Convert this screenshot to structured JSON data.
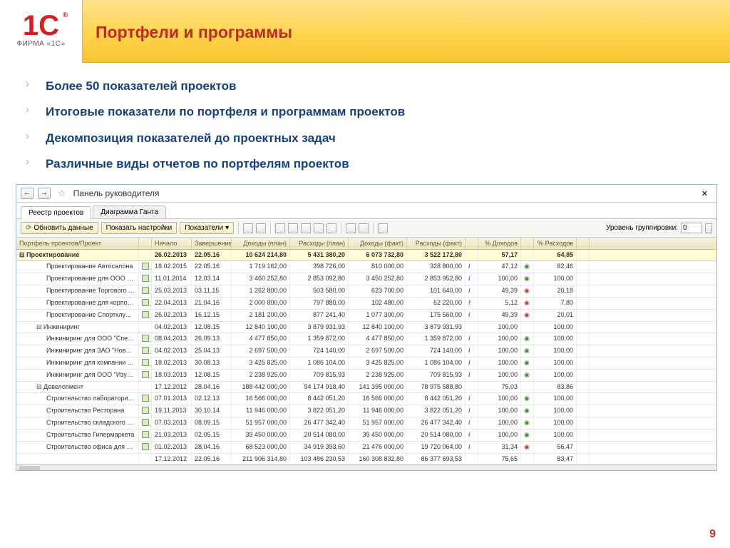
{
  "logo": {
    "text": "1C",
    "sub": "ФИРМА «1С»"
  },
  "title": "Портфели и программы",
  "bullets": [
    "Более 50 показателей проектов",
    "Итоговые показатели по портфеля и программам проектов",
    "Декомпозиция показателей до проектных задач",
    "Различные виды отчетов по портфелям проектов"
  ],
  "window": {
    "title": "Панель руководителя",
    "tabs": [
      "Реестр проектов",
      "Диаграмма Ганта"
    ],
    "refresh": "Обновить данные",
    "show_settings": "Показать настройки",
    "indicators": "Показатели",
    "group_label": "Уровень группировки:",
    "group_value": "0"
  },
  "columns": [
    "Портфель проектов/Проект",
    "",
    "Начало",
    "Завершение",
    "Доходы (план)",
    "Расходы (план)",
    "Доходы (факт)",
    "Расходы (факт)",
    "",
    "% Доходов",
    "",
    "% Расходов",
    ""
  ],
  "rows": [
    {
      "lvl": 0,
      "sel": true,
      "name": "Проектирование",
      "ic": "",
      "start": "26.02.2013",
      "end": "22.05.16",
      "dp": "10 624 214,80",
      "rp": "5 431 380,20",
      "df": "6 073 732,80",
      "rf": "3 522 172,80",
      "i": "",
      "pd": "57,17",
      "s": "",
      "pr": "64,85",
      "s2": ""
    },
    {
      "lvl": 2,
      "name": "Проектирование Автосалона",
      "ic": "doc",
      "start": "18.02.2015",
      "end": "22.05.16",
      "dp": "1 719 162,00",
      "rp": "398 726,00",
      "df": "810 000,00",
      "rf": "328 800,00",
      "i": "i",
      "pd": "47,12",
      "s": "g",
      "pr": "82,46",
      "s2": ""
    },
    {
      "lvl": 2,
      "name": "Проектирование для ООО \"Стройкорпорац…",
      "ic": "doc",
      "start": "11.01.2014",
      "end": "12.03.14",
      "dp": "3 460 252,80",
      "rp": "2 853 092,80",
      "df": "3 450 252,80",
      "rf": "2 853 952,80",
      "i": "i",
      "pd": "100,00",
      "s": "g",
      "pr": "100,00",
      "s2": ""
    },
    {
      "lvl": 2,
      "name": "Проектирование Торгового центра",
      "ic": "doc",
      "start": "25.03.2013",
      "end": "03.11.15",
      "dp": "1 262 800,00",
      "rp": "503 580,00",
      "df": "623 700,00",
      "rf": "101 640,00",
      "i": "i",
      "pd": "49,39",
      "s": "r",
      "pr": "20,18",
      "s2": ""
    },
    {
      "lvl": 2,
      "name": "Проектирование для корпорации \"Надежн…",
      "ic": "doc",
      "start": "22.04.2013",
      "end": "21.04.16",
      "dp": "2 000 800,00",
      "rp": "797 880,00",
      "df": "102 480,00",
      "rf": "62 220,00",
      "i": "r",
      "pd": "5,12",
      "s": "r",
      "pr": "7,80",
      "s2": ""
    },
    {
      "lvl": 2,
      "name": "Проектирование Спортклуба \"Аполлон\"",
      "ic": "doc",
      "start": "26.02.2013",
      "end": "16.12.15",
      "dp": "2 181 200,00",
      "rp": "877 241,40",
      "df": "1 077 300,00",
      "rf": "175 560,00",
      "i": "i",
      "pd": "49,39",
      "s": "r",
      "pr": "20,01",
      "s2": ""
    },
    {
      "lvl": 1,
      "name": "Инжиниринг",
      "ic": "",
      "start": "04.02.2013",
      "end": "12.08.15",
      "dp": "12 840 100,00",
      "rp": "3 879 931,93",
      "df": "12 840 100,00",
      "rf": "3 879 931,93",
      "i": "",
      "pd": "100,00",
      "s": "",
      "pr": "100,00",
      "s2": ""
    },
    {
      "lvl": 2,
      "name": "Инжиниринг для ООО \"Спектр\"",
      "ic": "doc",
      "start": "08.04.2013",
      "end": "26.09.13",
      "dp": "4 477 850,00",
      "rp": "1 359 872,00",
      "df": "4 477 850,00",
      "rf": "1 359 872,00",
      "i": "i",
      "pd": "100,00",
      "s": "g",
      "pr": "100,00",
      "s2": ""
    },
    {
      "lvl": 2,
      "name": "Инжиниринг для ЗАО \"Новый век\"",
      "ic": "doc",
      "start": "04.02.2013",
      "end": "25.04.13",
      "dp": "2 697 500,00",
      "rp": "724 140,00",
      "df": "2 697 500,00",
      "rf": "724 140,00",
      "i": "i",
      "pd": "100,00",
      "s": "g",
      "pr": "100,00",
      "s2": ""
    },
    {
      "lvl": 2,
      "name": "Инжиниринг для компании \"Надежная опо…",
      "ic": "doc",
      "start": "18.02.2013",
      "end": "30.08.13",
      "dp": "3 425 825,00",
      "rp": "1 086 104,00",
      "df": "3 425 825,00",
      "rf": "1 086 104,00",
      "i": "i",
      "pd": "100,00",
      "s": "g",
      "pr": "100,00",
      "s2": ""
    },
    {
      "lvl": 2,
      "name": "Инжиниринг для ООО \"Изумруд\"",
      "ic": "doc",
      "start": "18.03.2013",
      "end": "12.08.15",
      "dp": "2 238 925,00",
      "rp": "709 815,93",
      "df": "2 238 925,00",
      "rf": "709 815,93",
      "i": "i",
      "pd": "100,00",
      "s": "g",
      "pr": "100,00",
      "s2": ""
    },
    {
      "lvl": 1,
      "name": "Девелопмент",
      "ic": "",
      "start": "17.12.2012",
      "end": "28.04.16",
      "dp": "188 442 000,00",
      "rp": "94 174 918,40",
      "df": "141 395 000,00",
      "rf": "78 975 588,80",
      "i": "",
      "pd": "75,03",
      "s": "",
      "pr": "83,86",
      "s2": ""
    },
    {
      "lvl": 2,
      "name": "Строительство лаборатории для ООО \"Спе…",
      "ic": "doc",
      "start": "07.01.2013",
      "end": "02.12.13",
      "dp": "16 566 000,00",
      "rp": "8 442 051,20",
      "df": "16 566 000,00",
      "rf": "8 442 051,20",
      "i": "i",
      "pd": "100,00",
      "s": "g",
      "pr": "100,00",
      "s2": ""
    },
    {
      "lvl": 2,
      "name": "Строительство Ресторана",
      "ic": "doc",
      "start": "19.11.2013",
      "end": "30.10.14",
      "dp": "11 946 000,00",
      "rp": "3 822 051,20",
      "df": "11 946 000,00",
      "rf": "3 822 051,20",
      "i": "i",
      "pd": "100,00",
      "s": "g",
      "pr": "100,00",
      "s2": ""
    },
    {
      "lvl": 2,
      "name": "Строительство складского комплекса для …",
      "ic": "doc",
      "start": "07.03.2013",
      "end": "08.09.15",
      "dp": "51 957 000,00",
      "rp": "26 477 342,40",
      "df": "51 957 000,00",
      "rf": "26 477 342,40",
      "i": "i",
      "pd": "100,00",
      "s": "g",
      "pr": "100,00",
      "s2": ""
    },
    {
      "lvl": 2,
      "name": "Строительство Гипермаркета",
      "ic": "doc",
      "start": "21.03.2013",
      "end": "02.05.15",
      "dp": "39 450 000,00",
      "rp": "20 514 080,00",
      "df": "39 450 000,00",
      "rf": "20 514 080,00",
      "i": "i",
      "pd": "100,00",
      "s": "g",
      "pr": "100,00",
      "s2": ""
    },
    {
      "lvl": 2,
      "name": "Строительство офиса для корпорации \"На…",
      "ic": "doc",
      "start": "01.02.2013",
      "end": "28.04.16",
      "dp": "68 523 000,00",
      "rp": "34 919 393,60",
      "df": "21 476 000,00",
      "rf": "19 720 064,00",
      "i": "i",
      "pd": "31,34",
      "s": "r",
      "pr": "56,47",
      "s2": ""
    },
    {
      "lvl": 0,
      "name": "",
      "ic": "",
      "start": "17.12.2012",
      "end": "22.05.16",
      "dp": "211 906 314,80",
      "rp": "103 486 230,53",
      "df": "160 308 832,80",
      "rf": "86 377 693,53",
      "i": "",
      "pd": "75,65",
      "s": "",
      "pr": "83,47",
      "s2": ""
    }
  ],
  "page_number": "9"
}
